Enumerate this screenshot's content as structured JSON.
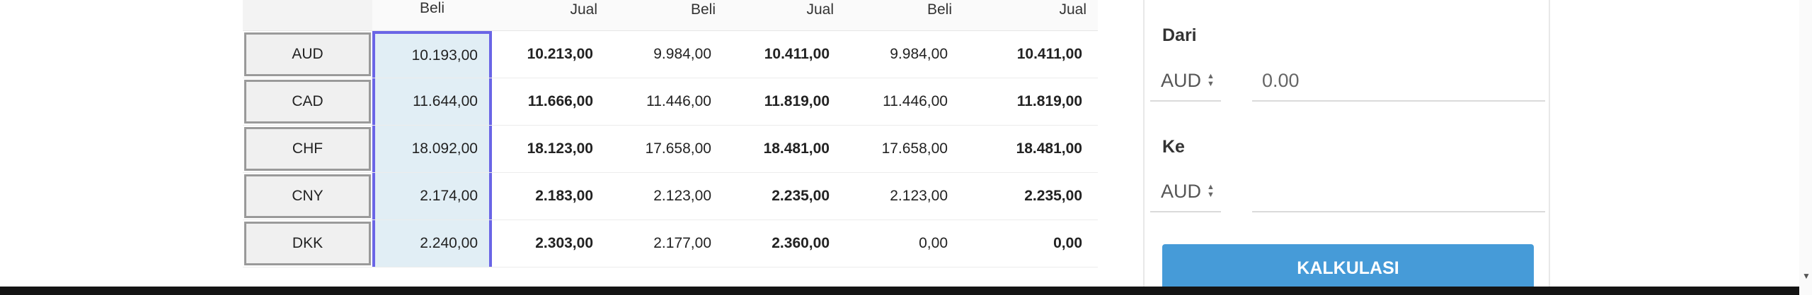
{
  "table": {
    "headers": [
      "",
      "Beli",
      "Jual",
      "Beli",
      "Jual",
      "Beli",
      "Jual"
    ],
    "rows": [
      {
        "currency": "AUD",
        "cells": [
          "10.193,00",
          "10.213,00",
          "9.984,00",
          "10.411,00",
          "9.984,00",
          "10.411,00"
        ]
      },
      {
        "currency": "CAD",
        "cells": [
          "11.644,00",
          "11.666,00",
          "11.446,00",
          "11.819,00",
          "11.446,00",
          "11.819,00"
        ]
      },
      {
        "currency": "CHF",
        "cells": [
          "18.092,00",
          "18.123,00",
          "17.658,00",
          "18.481,00",
          "17.658,00",
          "18.481,00"
        ]
      },
      {
        "currency": "CNY",
        "cells": [
          "2.174,00",
          "2.183,00",
          "2.123,00",
          "2.235,00",
          "2.123,00",
          "2.235,00"
        ]
      },
      {
        "currency": "DKK",
        "cells": [
          "2.240,00",
          "2.303,00",
          "2.177,00",
          "2.360,00",
          "0,00",
          "0,00"
        ]
      }
    ]
  },
  "converter": {
    "from_label": "Dari",
    "from_currency": "AUD",
    "amount_placeholder": "0.00",
    "to_label": "Ke",
    "to_currency": "AUD",
    "button_label": "KALKULASI"
  },
  "icons": {
    "select_arrows": "sort-arrows-icon",
    "scroll_down": "triangle-down-icon"
  },
  "colors": {
    "highlight_border": "#6a65e6",
    "highlight_fill": "#e1eef5",
    "button_blue": "#469bd8"
  }
}
